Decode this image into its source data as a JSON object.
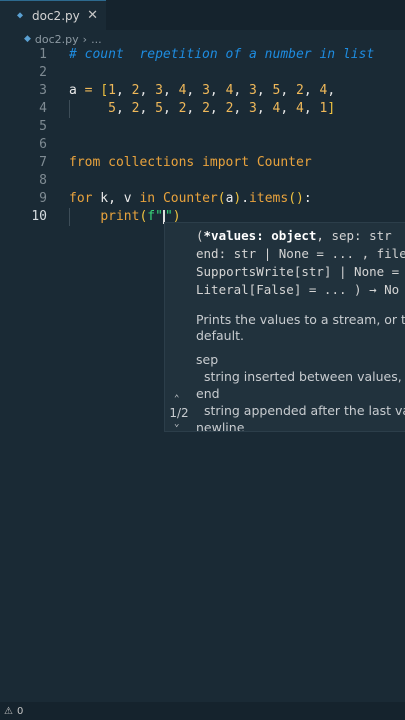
{
  "tab": {
    "filename": "doc2.py",
    "close": "✕"
  },
  "breadcrumb": {
    "file": "doc2.py",
    "sep": "›",
    "more": "..."
  },
  "lines": [
    {
      "n": "1",
      "tokens": [
        {
          "c": "cmt",
          "t": "# count  repetition of a number in list"
        }
      ]
    },
    {
      "n": "2",
      "tokens": []
    },
    {
      "n": "3",
      "tokens": [
        {
          "c": "var",
          "t": "a "
        },
        {
          "c": "op",
          "t": "="
        },
        {
          "c": "var",
          "t": " "
        },
        {
          "c": "br",
          "t": "["
        },
        {
          "c": "num",
          "t": "1"
        },
        {
          "c": "var",
          "t": ", "
        },
        {
          "c": "num",
          "t": "2"
        },
        {
          "c": "var",
          "t": ", "
        },
        {
          "c": "num",
          "t": "3"
        },
        {
          "c": "var",
          "t": ", "
        },
        {
          "c": "num",
          "t": "4"
        },
        {
          "c": "var",
          "t": ", "
        },
        {
          "c": "num",
          "t": "3"
        },
        {
          "c": "var",
          "t": ", "
        },
        {
          "c": "num",
          "t": "4"
        },
        {
          "c": "var",
          "t": ", "
        },
        {
          "c": "num",
          "t": "3"
        },
        {
          "c": "var",
          "t": ", "
        },
        {
          "c": "num",
          "t": "5"
        },
        {
          "c": "var",
          "t": ", "
        },
        {
          "c": "num",
          "t": "2"
        },
        {
          "c": "var",
          "t": ", "
        },
        {
          "c": "num",
          "t": "4"
        },
        {
          "c": "var",
          "t": ","
        }
      ]
    },
    {
      "n": "4",
      "tokens": [
        {
          "c": "var",
          "t": "     "
        },
        {
          "c": "num",
          "t": "5"
        },
        {
          "c": "var",
          "t": ", "
        },
        {
          "c": "num",
          "t": "2"
        },
        {
          "c": "var",
          "t": ", "
        },
        {
          "c": "num",
          "t": "5"
        },
        {
          "c": "var",
          "t": ", "
        },
        {
          "c": "num",
          "t": "2"
        },
        {
          "c": "var",
          "t": ", "
        },
        {
          "c": "num",
          "t": "2"
        },
        {
          "c": "var",
          "t": ", "
        },
        {
          "c": "num",
          "t": "2"
        },
        {
          "c": "var",
          "t": ", "
        },
        {
          "c": "num",
          "t": "3"
        },
        {
          "c": "var",
          "t": ", "
        },
        {
          "c": "num",
          "t": "4"
        },
        {
          "c": "var",
          "t": ", "
        },
        {
          "c": "num",
          "t": "4"
        },
        {
          "c": "var",
          "t": ", "
        },
        {
          "c": "num",
          "t": "1"
        },
        {
          "c": "br",
          "t": "]"
        }
      ]
    },
    {
      "n": "5",
      "tokens": []
    },
    {
      "n": "6",
      "tokens": []
    },
    {
      "n": "7",
      "tokens": [
        {
          "c": "kw",
          "t": "from"
        },
        {
          "c": "var",
          "t": " "
        },
        {
          "c": "fn",
          "t": "collections"
        },
        {
          "c": "var",
          "t": " "
        },
        {
          "c": "kw",
          "t": "import"
        },
        {
          "c": "var",
          "t": " "
        },
        {
          "c": "fn",
          "t": "Counter"
        }
      ]
    },
    {
      "n": "8",
      "tokens": []
    },
    {
      "n": "9",
      "tokens": [
        {
          "c": "kw",
          "t": "for"
        },
        {
          "c": "var",
          "t": " k, v "
        },
        {
          "c": "kw",
          "t": "in"
        },
        {
          "c": "var",
          "t": " "
        },
        {
          "c": "fn",
          "t": "Counter"
        },
        {
          "c": "br",
          "t": "("
        },
        {
          "c": "var",
          "t": "a"
        },
        {
          "c": "br",
          "t": ")"
        },
        {
          "c": "var",
          "t": "."
        },
        {
          "c": "fn",
          "t": "items"
        },
        {
          "c": "br",
          "t": "()"
        },
        {
          "c": "var",
          "t": ":"
        }
      ]
    },
    {
      "n": "10",
      "tokens": [
        {
          "c": "var",
          "t": "    "
        },
        {
          "c": "fn",
          "t": "print"
        },
        {
          "c": "br",
          "t": "("
        },
        {
          "c": "str",
          "t": "f\""
        },
        {
          "c": "cursor",
          "t": ""
        },
        {
          "c": "str",
          "t": "\""
        },
        {
          "c": "br",
          "t": ")"
        }
      ]
    }
  ],
  "popup": {
    "sig_line1_a": "(",
    "sig_line1_b": "*values: object",
    "sig_line1_c": ", sep: str",
    "sig_line2": "end: str | None = ... , file",
    "sig_line3": "SupportsWrite[str] | None =",
    "sig_line4": "Literal[False] = ... ) → No",
    "doc1": "Prints the values to a stream, or to s",
    "doc2": "default.",
    "doc3": "sep",
    "doc4": "  string inserted between values, de",
    "doc5": "end",
    "doc6": "  string appended after the last valu",
    "doc7": "newline",
    "pager": "1/2"
  },
  "status": {
    "warnings": "0"
  }
}
